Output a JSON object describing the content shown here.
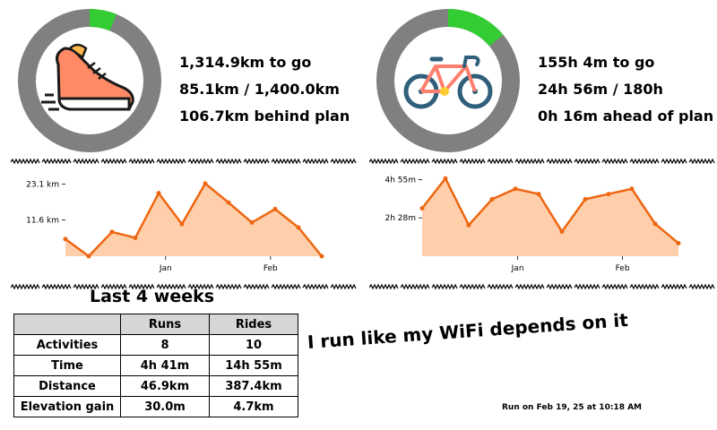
{
  "run_goal": {
    "icon": "running-shoe-icon",
    "progress": 0.061,
    "progress_color": "#33cc33",
    "ring_color": "#808080",
    "lines": [
      "1,314.9km to go",
      "85.1km / 1,400.0km",
      "106.7km behind plan"
    ]
  },
  "ride_goal": {
    "icon": "bicycle-icon",
    "progress": 0.139,
    "progress_color": "#33cc33",
    "ring_color": "#808080",
    "lines": [
      "155h 4m to go",
      "24h 56m / 180h",
      "0h 16m ahead of plan"
    ]
  },
  "chart_data": [
    {
      "type": "area",
      "name": "run-distance",
      "line_color": "#ee6611",
      "fill_color": "#ffcfab",
      "yticks": [
        {
          "label": "23.1 km",
          "value": 23.1
        },
        {
          "label": "11.6 km",
          "value": 11.6
        }
      ],
      "ylim": [
        0,
        27
      ],
      "xticks": [
        {
          "label": "Jan",
          "index": 4.3
        },
        {
          "label": "Feb",
          "index": 8.8
        }
      ],
      "values": [
        5.5,
        0,
        7.8,
        5.9,
        20.2,
        10.3,
        23.3,
        17.2,
        10.8,
        15.1,
        9.2,
        0
      ]
    },
    {
      "type": "area",
      "name": "ride-time",
      "line_color": "#ee6611",
      "fill_color": "#ffcfab",
      "yticks": [
        {
          "label": "4h 55m",
          "value": 295
        },
        {
          "label": "2h 28m",
          "value": 148
        }
      ],
      "ylim": [
        0,
        325
      ],
      "xticks": [
        {
          "label": "Jan",
          "index": 4.1
        },
        {
          "label": "Feb",
          "index": 8.6
        }
      ],
      "values": [
        185,
        300,
        120,
        220,
        260,
        240,
        95,
        220,
        240,
        260,
        125,
        50
      ]
    }
  ],
  "section_title": "Last 4 weeks",
  "table": {
    "headers": [
      "",
      "Runs",
      "Rides"
    ],
    "rows": [
      [
        "Activities",
        "8",
        "10"
      ],
      [
        "Time",
        "4h 41m",
        "14h 55m"
      ],
      [
        "Distance",
        "46.9km",
        "387.4km"
      ],
      [
        "Elevation gain",
        "30.0m",
        "4.7km"
      ]
    ]
  },
  "motto": "I run like my WiFi depends on it",
  "run_date": "Run on Feb 19, 25 at 10:18 AM"
}
